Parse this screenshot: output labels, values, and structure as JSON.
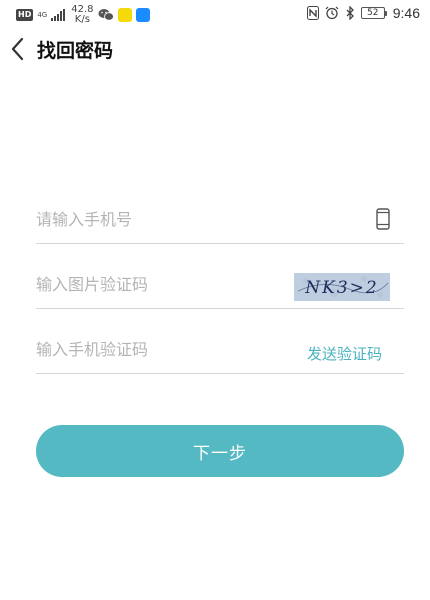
{
  "status_bar": {
    "hd": "HD",
    "net_type": "4G",
    "speed_value": "42.8",
    "speed_unit": "K/s",
    "battery": "52",
    "time": "9:46"
  },
  "header": {
    "title": "找回密码"
  },
  "form": {
    "phone_placeholder": "请输入手机号",
    "captcha_placeholder": "输入图片验证码",
    "captcha_text": "NK3>2",
    "sms_placeholder": "输入手机验证码",
    "send_code_label": "发送验证码",
    "next_label": "下一步"
  },
  "colors": {
    "accent": "#55b9c3",
    "link": "#4ab3bf",
    "placeholder": "#b4b4b4",
    "divider": "#d6d6d6"
  },
  "icons": {
    "back": "chevron-left-icon",
    "phone": "mobile-phone-icon"
  }
}
